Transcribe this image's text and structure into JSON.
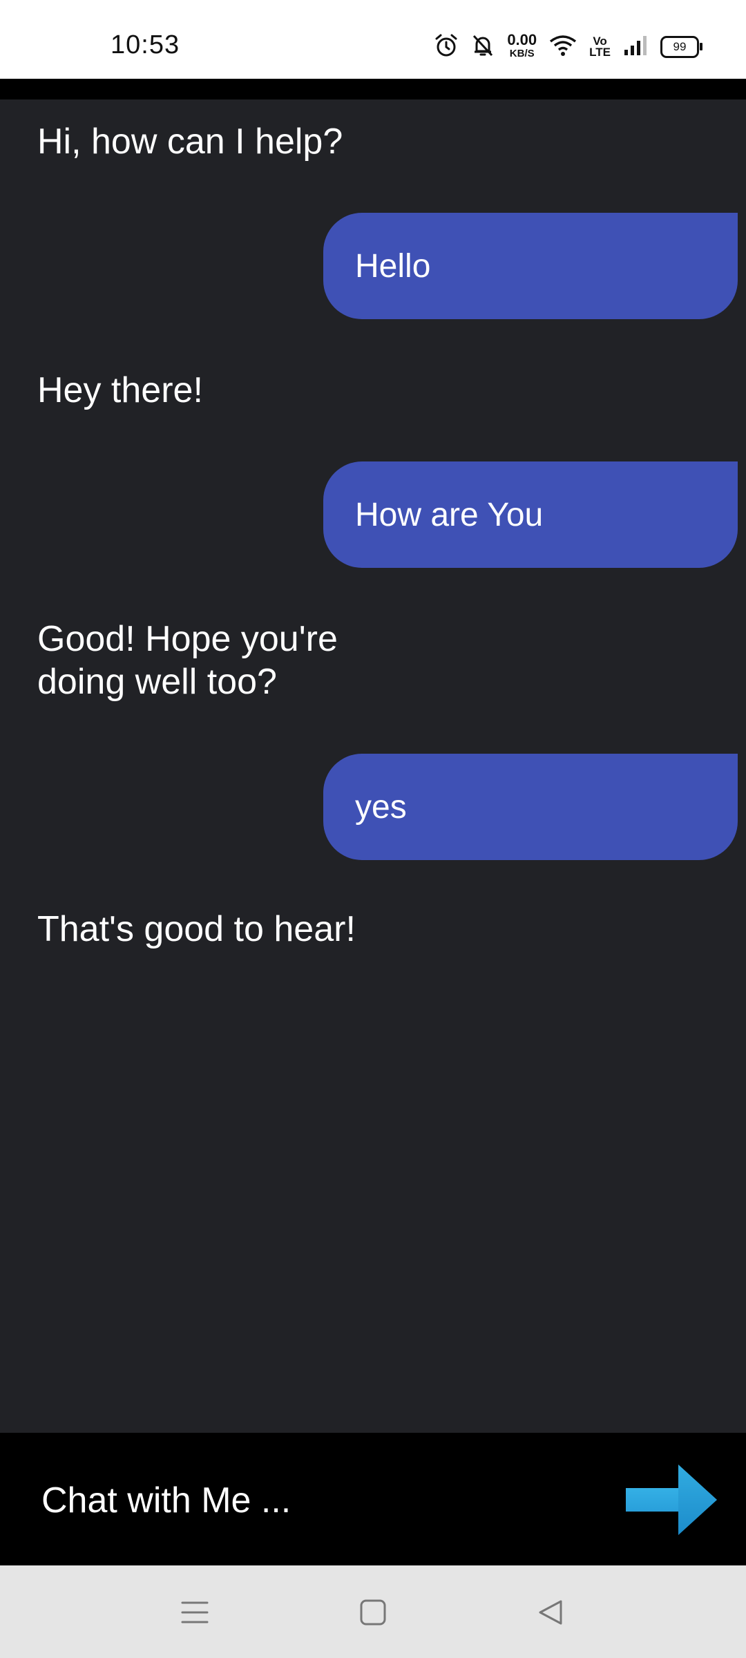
{
  "status_bar": {
    "time": "10:53",
    "net_speed": "0.00",
    "net_speed_unit": "KB/S",
    "volte_top": "Vo",
    "volte_bottom": "LTE",
    "battery": "99"
  },
  "messages": [
    {
      "role": "bot",
      "text": "Hi, how can I help?"
    },
    {
      "role": "user",
      "text": "Hello"
    },
    {
      "role": "bot",
      "text": "Hey there!"
    },
    {
      "role": "user",
      "text": "How are You"
    },
    {
      "role": "bot",
      "text": "Good! Hope you're doing well too?"
    },
    {
      "role": "user",
      "text": "yes"
    },
    {
      "role": "bot",
      "text": "That's good to hear!"
    }
  ],
  "input": {
    "placeholder": "Chat with Me ...",
    "value": ""
  },
  "colors": {
    "background": "#212226",
    "user_bubble": "#3f51b5",
    "send_arrow": "#29a8e6",
    "nav_bar": "#e5e5e5"
  },
  "icons": {
    "send": "arrow-right-icon",
    "nav_menu": "menu-icon",
    "nav_home": "home-square-icon",
    "nav_back": "back-triangle-icon"
  }
}
